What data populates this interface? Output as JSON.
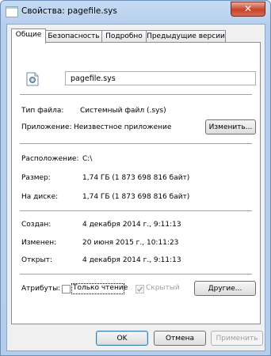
{
  "window": {
    "title": "Свойства: pagefile.sys",
    "close_glyph": "✕"
  },
  "tabs": [
    {
      "label": "Общие"
    },
    {
      "label": "Безопасность"
    },
    {
      "label": "Подробно"
    },
    {
      "label": "Предыдущие версии"
    }
  ],
  "general": {
    "file_name": "pagefile.sys",
    "file_type_label": "Тип файла:",
    "file_type_value": "Системный файл (.sys)",
    "app_label": "Приложение:",
    "app_value": "Неизвестное приложение",
    "change_button": "Изменить...",
    "location_label": "Расположение:",
    "location_value": "C:\\",
    "size_label": "Размер:",
    "size_value": "1,74 ГБ (1 873 698 816 байт)",
    "disk_label": "На диске:",
    "disk_value": "1,74 ГБ (1 873 698 816 байт)",
    "created_label": "Создан:",
    "created_value": "4 декабря 2014 г., 9:11:13",
    "modified_label": "Изменен:",
    "modified_value": "20 июня 2015 г., 10:11:23",
    "opened_label": "Открыт:",
    "opened_value": "4 декабря 2014 г., 9:11:13",
    "attributes_label": "Атрибуты:",
    "readonly_label": "Только чтение",
    "readonly_checked": false,
    "hidden_label": "Скрытый",
    "hidden_checked": true,
    "other_button": "Другие..."
  },
  "footer": {
    "ok": "OK",
    "cancel": "Отмена",
    "apply": "Применить"
  }
}
